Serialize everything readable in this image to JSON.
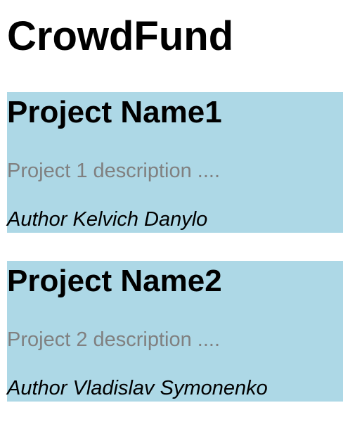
{
  "app": {
    "title": "CrowdFund"
  },
  "theme": {
    "card_background": "#add8e6",
    "description_color": "#808080"
  },
  "projects": [
    {
      "name": "Project Name1",
      "description": "Project 1 description ....",
      "author": "Author Kelvich Danylo"
    },
    {
      "name": "Project Name2",
      "description": "Project 2 description ....",
      "author": "Author Vladislav Symonenko"
    }
  ]
}
